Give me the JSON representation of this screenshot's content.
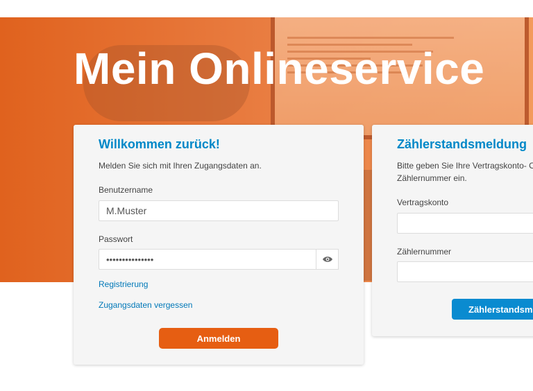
{
  "hero": {
    "title": "Mein Onlineservice"
  },
  "login": {
    "heading": "Willkommen zurück!",
    "intro": "Melden Sie sich mit Ihren Zugangsdaten an.",
    "username_label": "Benutzername",
    "username_value": "M.Muster",
    "password_label": "Passwort",
    "password_value": "•••••••••••••••",
    "register_link": "Registrierung",
    "forgot_link": "Zugangsdaten vergessen",
    "submit_label": "Anmelden"
  },
  "meter": {
    "heading": "Zählerstandsmeldung",
    "intro_line1": "Bitte geben Sie Ihre Vertragskonto- O",
    "intro_line2": "Zählernummer ein.",
    "contract_label": "Vertragskonto",
    "contract_value": "",
    "meter_label": "Zählernummer",
    "meter_value": "",
    "submit_label": "Zählerstandsmeldung"
  },
  "colors": {
    "accent_orange": "#e65e12",
    "accent_blue": "#0a8bd0",
    "heading_blue": "#0088c8"
  },
  "icons": {
    "password_toggle": "eye-icon"
  }
}
